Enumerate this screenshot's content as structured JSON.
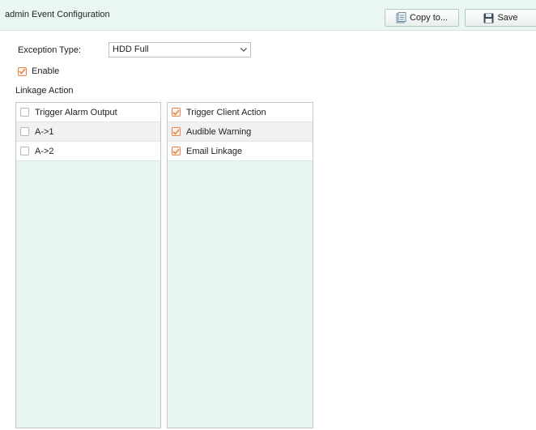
{
  "header": {
    "title": "admin Event Configuration",
    "copy_label": "Copy to...",
    "save_label": "Save"
  },
  "form": {
    "exception_type_label": "Exception Type:",
    "exception_type_value": "HDD Full",
    "enable_label": "Enable",
    "enable_checked": true,
    "linkage_label": "Linkage Action"
  },
  "left_list": {
    "items": [
      {
        "label": "Trigger Alarm Output",
        "checked": false
      },
      {
        "label": "A->1",
        "checked": false
      },
      {
        "label": "A->2",
        "checked": false
      }
    ]
  },
  "right_list": {
    "items": [
      {
        "label": "Trigger Client Action",
        "checked": true
      },
      {
        "label": "Audible Warning",
        "checked": true
      },
      {
        "label": "Email Linkage",
        "checked": true
      }
    ]
  },
  "colors": {
    "accent": "#e3854d",
    "header_bg": "#eaf6f2",
    "panel_bg": "#e8f5f0"
  }
}
